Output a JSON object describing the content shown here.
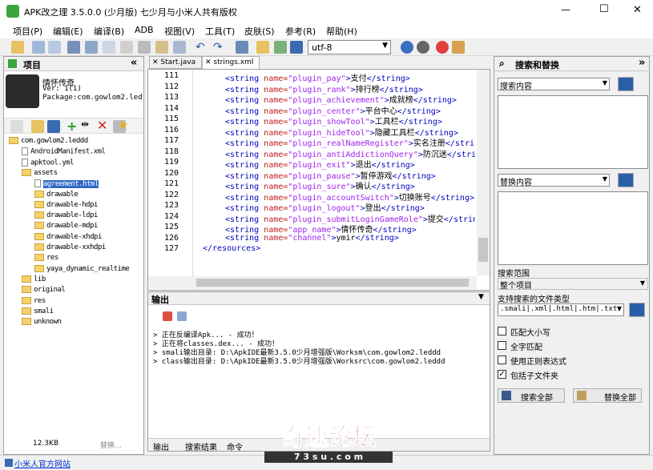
{
  "window": {
    "title": "APK改之理 3.5.0.0 (少月版)  七少月与小米人共有版权",
    "minimize": "—",
    "maximize": "☐",
    "close": "✕"
  },
  "menu": [
    "项目(P)",
    "编辑(E)",
    "编译(B)",
    "ADB",
    "视图(V)",
    "工具(T)",
    "皮肤(S)",
    "参考(R)",
    "帮助(H)"
  ],
  "toolbar": {
    "encoding": "utf-8"
  },
  "project_panel": {
    "title": "项目",
    "collapse": "«",
    "app_name": "情怀传奇",
    "version": "Ver: 1(1)",
    "package": "Package:com.gowlom2.leddd",
    "size": "12.3KB",
    "replace_btn": "替换..."
  },
  "tree": [
    {
      "label": "com.gowlom2.leddd",
      "indent": 0,
      "kind": "root"
    },
    {
      "label": "AndroidManifest.xml",
      "indent": 1,
      "kind": "file"
    },
    {
      "label": "apktool.yml",
      "indent": 1,
      "kind": "file"
    },
    {
      "label": "assets",
      "indent": 1,
      "kind": "folder"
    },
    {
      "label": "agreement.html",
      "indent": 2,
      "kind": "file",
      "selected": true
    },
    {
      "label": "drawable",
      "indent": 2,
      "kind": "folder"
    },
    {
      "label": "drawable-hdpi",
      "indent": 2,
      "kind": "folder"
    },
    {
      "label": "drawable-ldpi",
      "indent": 2,
      "kind": "folder"
    },
    {
      "label": "drawable-mdpi",
      "indent": 2,
      "kind": "folder"
    },
    {
      "label": "drawable-xhdpi",
      "indent": 2,
      "kind": "folder"
    },
    {
      "label": "drawable-xxhdpi",
      "indent": 2,
      "kind": "folder"
    },
    {
      "label": "res",
      "indent": 2,
      "kind": "folder"
    },
    {
      "label": "yaya_dynamic_realtime",
      "indent": 2,
      "kind": "folder"
    },
    {
      "label": "lib",
      "indent": 1,
      "kind": "folder"
    },
    {
      "label": "original",
      "indent": 1,
      "kind": "folder"
    },
    {
      "label": "res",
      "indent": 1,
      "kind": "folder"
    },
    {
      "label": "smali",
      "indent": 1,
      "kind": "folder"
    },
    {
      "label": "unknown",
      "indent": 1,
      "kind": "folder"
    }
  ],
  "tabs": [
    {
      "label": "Start.java",
      "active": false
    },
    {
      "label": "strings.xml",
      "active": true
    }
  ],
  "code_lines": [
    {
      "n": "111",
      "name": "plugin_pay",
      "text": "支付"
    },
    {
      "n": "112",
      "name": "plugin_rank",
      "text": "排行榜"
    },
    {
      "n": "113",
      "name": "plugin_achievement",
      "text": "成就榜"
    },
    {
      "n": "114",
      "name": "plugin_center",
      "text": "平台中心"
    },
    {
      "n": "115",
      "name": "plugin_showTool",
      "text": "工具栏"
    },
    {
      "n": "116",
      "name": "plugin_hideTool",
      "text": "隐藏工具栏"
    },
    {
      "n": "117",
      "name": "plugin_realNameRegister",
      "text": "实名注册"
    },
    {
      "n": "118",
      "name": "plugin_antiAddictionQuery",
      "text": "防沉迷"
    },
    {
      "n": "119",
      "name": "plugin_exit",
      "text": "退出"
    },
    {
      "n": "120",
      "name": "plugin_pause",
      "text": "暂停游戏"
    },
    {
      "n": "121",
      "name": "plugin_sure",
      "text": "确认"
    },
    {
      "n": "122",
      "name": "plugin_accountSwitch",
      "text": "切换账号"
    },
    {
      "n": "123",
      "name": "plugin_logout",
      "text": "登出"
    },
    {
      "n": "124",
      "name": "plugin_submitLoginGameRole",
      "text": "提交"
    },
    {
      "n": "125",
      "name": "app_name",
      "text": "情怀传奇"
    },
    {
      "n": "126",
      "name": "channel",
      "text": "ymir"
    }
  ],
  "code_end": {
    "n": "127",
    "text": "</resources>"
  },
  "output": {
    "title": "输出",
    "lines": [
      "> 正在反编译Apk... - 成功！",
      "> 正在将classes.dex... - 成功！",
      "> smali输出目录: D:\\ApkIDE最新3.5.0少月增强版\\Worksm\\com.gowlom2.leddd",
      "> class输出目录: D:\\ApkIDE最新3.5.0少月增强版\\Worksrc\\com.gowlom2.leddd"
    ],
    "tabs": [
      "输出",
      "搜索结果",
      "命令"
    ]
  },
  "search_panel": {
    "title": "搜索和替换",
    "search_placeholder": "搜索内容",
    "replace_placeholder": "替换内容",
    "scope_label": "搜索范围",
    "scope_value": "整个项目",
    "filetype_label": "支持搜索的文件类型",
    "filetype_value": ".smali|.xml|.html|.htm|.txt",
    "options": [
      {
        "label": "匹配大小写",
        "checked": false
      },
      {
        "label": "全字匹配",
        "checked": false
      },
      {
        "label": "使用正则表达式",
        "checked": false
      },
      {
        "label": "包括子文件夹",
        "checked": true
      }
    ],
    "search_all": "搜索全部",
    "replace_all": "替换全部"
  },
  "status": {
    "link": "小米人官方网站"
  },
  "watermark": {
    "big": "奇速论坛",
    "small": "7 3 s u . c o m"
  }
}
